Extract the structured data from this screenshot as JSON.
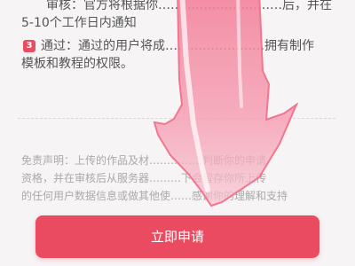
{
  "rules": [
    {
      "badge": "",
      "lines": [
        "审核：官方将根据你…………………………后，并在",
        "5-10个工作日内通知"
      ]
    },
    {
      "badge": "3",
      "lines": [
        "通过：通过的用户将成……………………拥有制作",
        "模板和教程的权限。"
      ]
    },
    {
      "badge": "",
      "lines": []
    }
  ],
  "disclaimer": {
    "lines": [
      "免责声明：上传的作品及材……………判断你的申请",
      "资格，并在审核后从服务器………下会留存你所上传",
      "的任何用户数据信息或做其他使……感谢你的理解和支持"
    ]
  },
  "apply_button": {
    "label": "立即申请"
  },
  "overlay": {
    "arrow_color": "#f08aa0"
  }
}
